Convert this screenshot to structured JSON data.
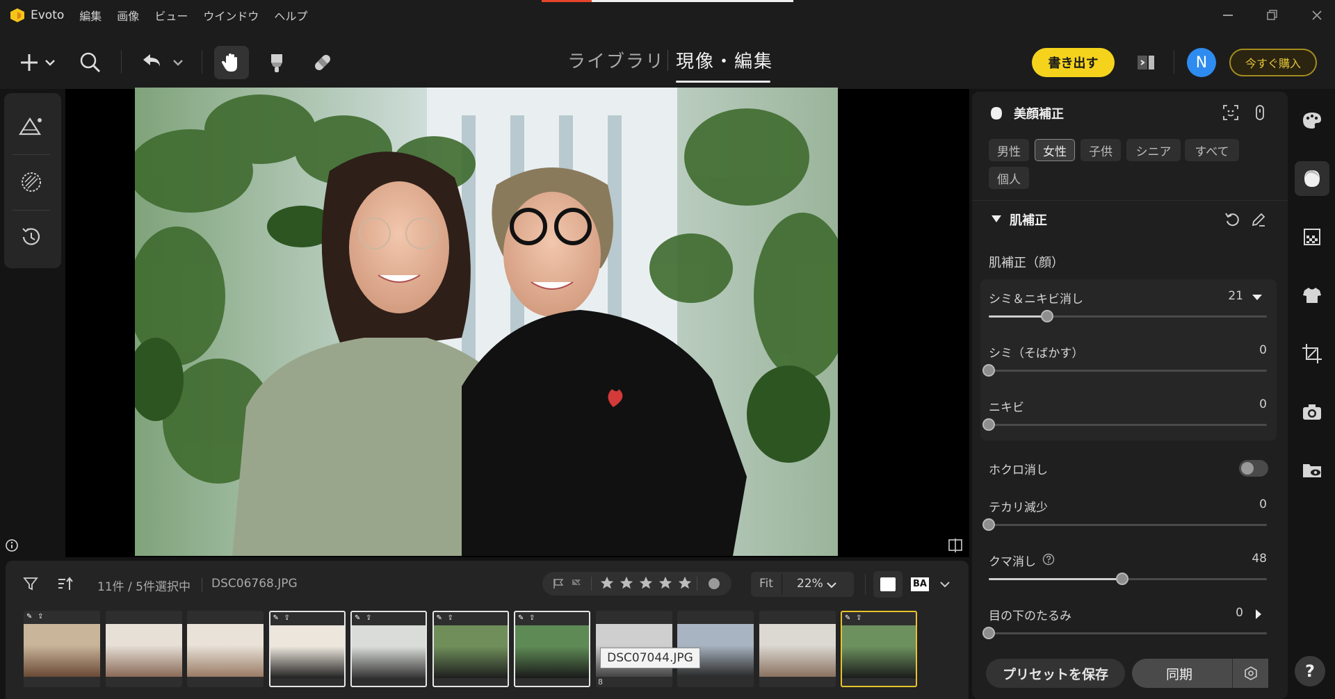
{
  "app": {
    "name": "Evoto"
  },
  "menu": [
    "編集",
    "画像",
    "ビュー",
    "ウインドウ",
    "ヘルプ"
  ],
  "tabs": {
    "library": "ライブラリ",
    "develop": "現像・編集"
  },
  "header": {
    "export_label": "書き出す",
    "avatar_initial": "N",
    "buy_label": "今すぐ購入"
  },
  "filmstrip": {
    "count_label": "11件 / 5件選択中",
    "filename": "DSC06768.JPG",
    "fit_label": "Fit",
    "zoom": "22%",
    "ba_label": "BA",
    "tooltip": "DSC07044.JPG",
    "thumb_badge": "8",
    "rating_stars": 5,
    "thumbnails": [
      {
        "id": "t1",
        "selected": false,
        "current": false,
        "edited": true
      },
      {
        "id": "t2",
        "selected": false,
        "current": false,
        "edited": false
      },
      {
        "id": "t3",
        "selected": false,
        "current": false,
        "edited": false
      },
      {
        "id": "t4",
        "selected": true,
        "current": false,
        "edited": true
      },
      {
        "id": "t5",
        "selected": true,
        "current": false,
        "edited": true
      },
      {
        "id": "t6",
        "selected": true,
        "current": false,
        "edited": true
      },
      {
        "id": "t7",
        "selected": true,
        "current": false,
        "edited": true
      },
      {
        "id": "t8",
        "selected": false,
        "current": false,
        "edited": false
      },
      {
        "id": "t9",
        "selected": false,
        "current": false,
        "edited": false
      },
      {
        "id": "t10",
        "selected": false,
        "current": false,
        "edited": false
      },
      {
        "id": "t11",
        "selected": false,
        "current": true,
        "edited": true
      }
    ]
  },
  "panel": {
    "title": "美顔補正",
    "chips": [
      "男性",
      "女性",
      "子供",
      "シニア",
      "すべて",
      "個人"
    ],
    "active_chip": "女性",
    "section_title": "肌補正",
    "subsection_title": "肌補正（顔）",
    "sliders": {
      "blemish": {
        "label": "シミ＆ニキビ消し",
        "value": "21",
        "level": 0.21
      },
      "spots": {
        "label": "シミ（そばかす）",
        "value": "0",
        "level": 0
      },
      "acne": {
        "label": "ニキビ",
        "value": "0",
        "level": 0
      },
      "shine": {
        "label": "テカリ減少",
        "value": "0",
        "level": 0
      },
      "darkcircle": {
        "label": "クマ消し",
        "value": "48",
        "level": 0.48
      },
      "undereye": {
        "label": "目の下のたるみ",
        "value": "0",
        "level": 0
      }
    },
    "mole_label": "ホクロ消し",
    "mole_enabled": false,
    "save_preset_label": "プリセットを保存",
    "sync_label": "同期"
  },
  "colors": {
    "accent": "#f5d31c",
    "avatar": "#2e8cf0",
    "current_border": "#e8c42c"
  }
}
